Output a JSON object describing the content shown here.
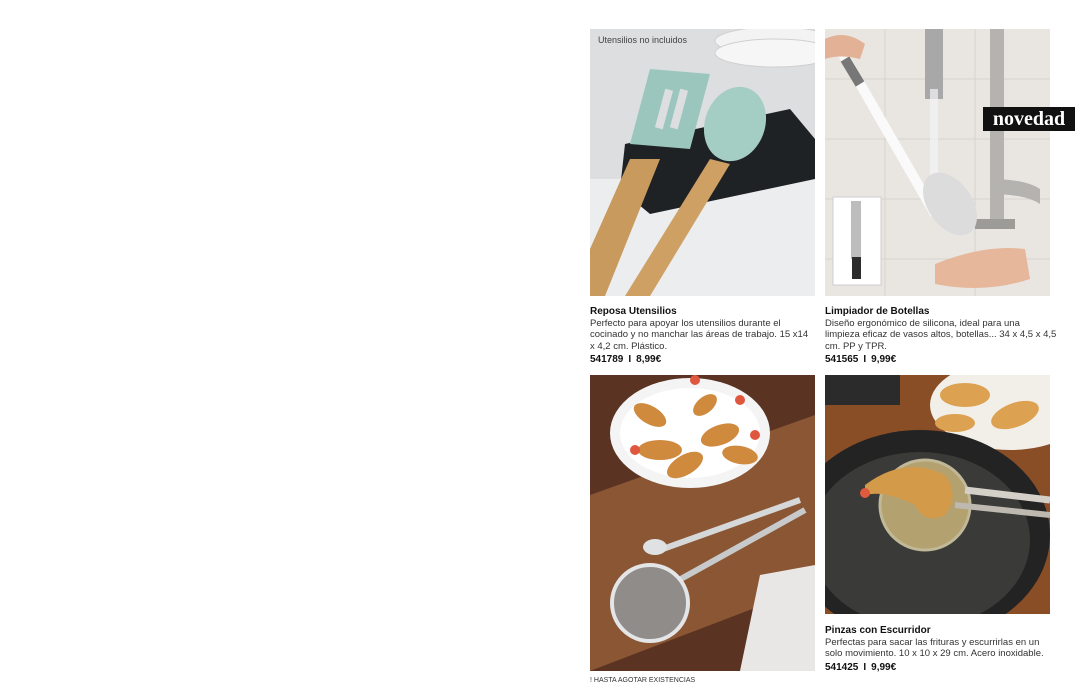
{
  "products": [
    {
      "overlay_note": "Utensilios no incluidos",
      "title": "Reposa Utensilios",
      "description": "Perfecto para apoyar los utensilios durante el cocinado y no manchar las áreas de trabajo. 15 x14 x 4,2 cm. Plástico.",
      "code": "541789",
      "price": "8,99€"
    },
    {
      "badge": "novedad",
      "title": "Limpiador de Botellas",
      "description": "Diseño ergonómico de silicona, ideal para una limpieza eficaz de vasos altos, botellas... 34 x 4,5 x 4,5 cm. PP y TPR.",
      "code": "541565",
      "price": "9,99€"
    },
    {
      "title": "Pinzas con Escurridor",
      "description": "Perfectas para sacar las frituras y escurrirlas en un solo movimiento. 10 x 10 x 29 cm. Acero inoxidable.",
      "code": "541425",
      "price": "9,99€"
    }
  ],
  "separator": "I",
  "footnote": "! HASTA AGOTAR EXISTENCIAS"
}
